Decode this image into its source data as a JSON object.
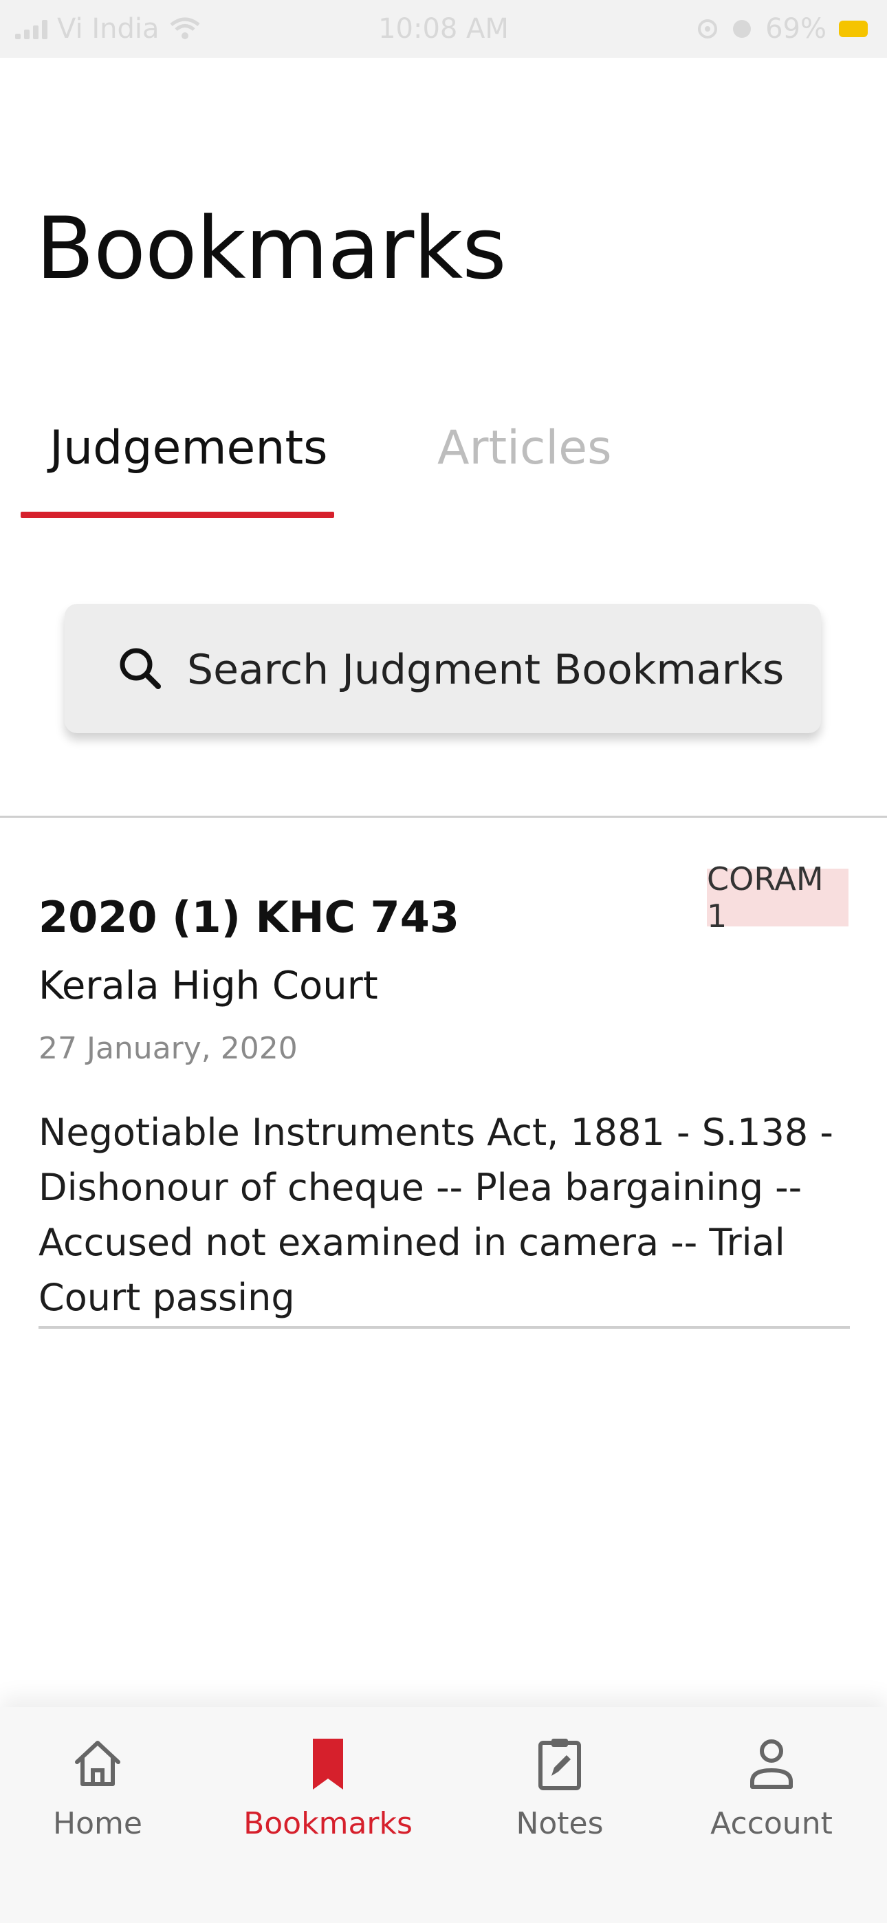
{
  "status_bar": {
    "carrier": "Vi India",
    "time": "10:08 AM",
    "battery": "69%",
    "battery_color": "#f5c400"
  },
  "page": {
    "title": "Bookmarks"
  },
  "tabs": [
    {
      "label": "Judgements",
      "active": true
    },
    {
      "label": "Articles",
      "active": false
    }
  ],
  "search": {
    "placeholder": "Search Judgment Bookmarks",
    "value": ""
  },
  "bookmarks": [
    {
      "citation": "2020 (1) KHC 743",
      "badge": "CORAM 1",
      "court": "Kerala High Court",
      "date": "27 January, 2020",
      "summary": "Negotiable Instruments Act, 1881 - S.138 - Dishonour of cheque -- Plea bargaining -- Accused not examined in camera -- Trial Court passing"
    }
  ],
  "bottom_nav": [
    {
      "label": "Home",
      "icon": "home-icon",
      "active": false
    },
    {
      "label": "Bookmarks",
      "icon": "bookmark-icon",
      "active": true
    },
    {
      "label": "Notes",
      "icon": "notes-icon",
      "active": false
    },
    {
      "label": "Account",
      "icon": "account-icon",
      "active": false
    }
  ],
  "colors": {
    "accent": "#d6202c",
    "badge_bg": "#f8dede",
    "inactive_tab": "#bdbdbd"
  }
}
